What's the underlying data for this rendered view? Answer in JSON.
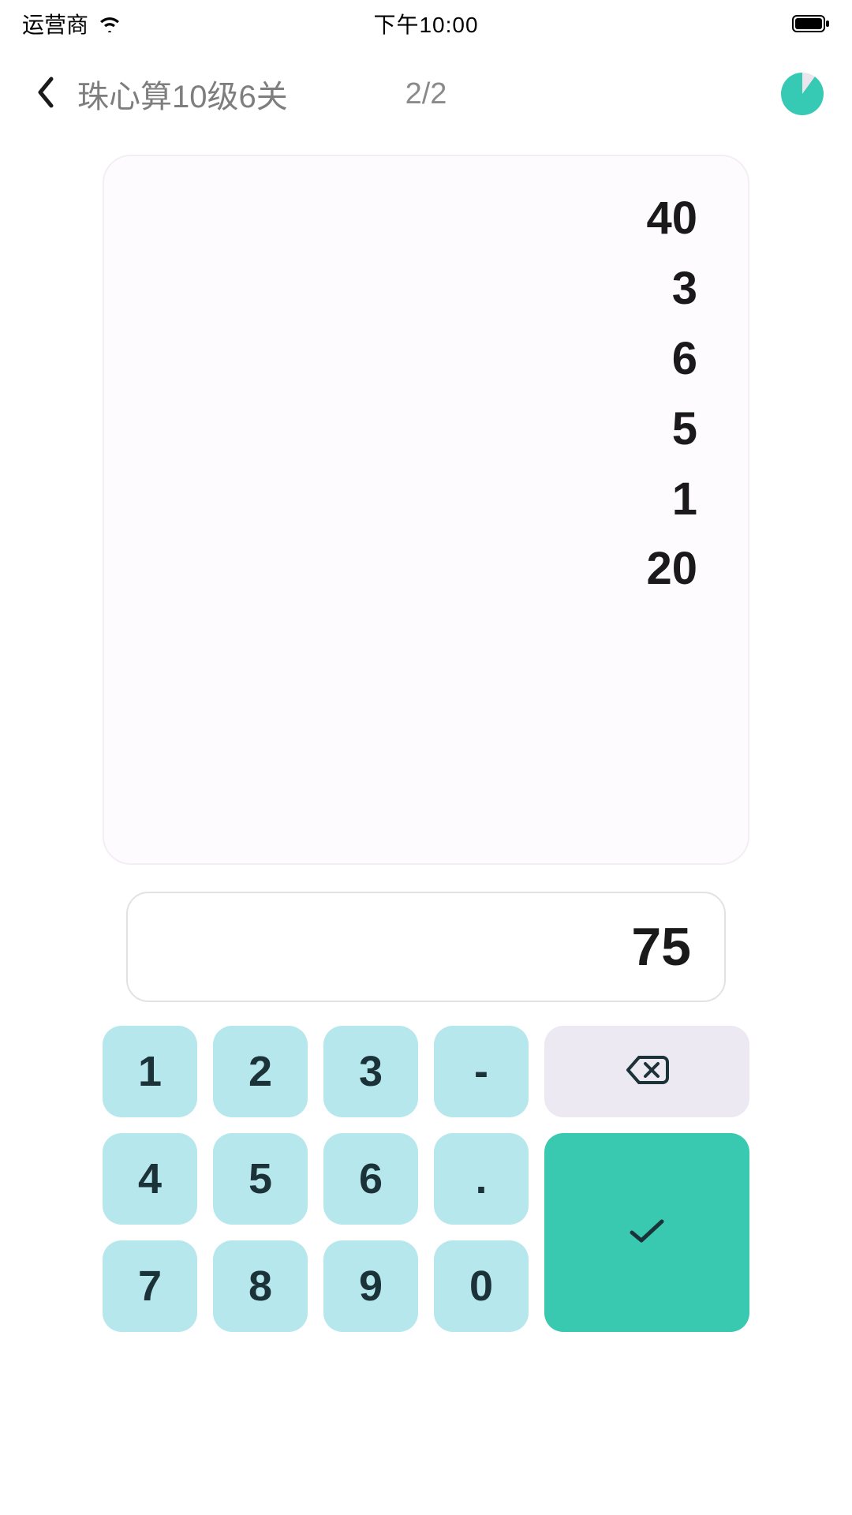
{
  "status_bar": {
    "carrier": "运营商",
    "time": "下午10:00"
  },
  "header": {
    "title": "珠心算10级6关",
    "progress": "2/2",
    "timer_fraction_elapsed": 0.1
  },
  "problem": {
    "numbers": [
      "40",
      "3",
      "6",
      "5",
      "1",
      "20"
    ]
  },
  "answer": {
    "value": "75"
  },
  "keypad": {
    "k1": "1",
    "k2": "2",
    "k3": "3",
    "minus": "-",
    "k4": "4",
    "k5": "5",
    "k6": "6",
    "dot": ".",
    "k7": "7",
    "k8": "8",
    "k9": "9",
    "k0": "0"
  }
}
